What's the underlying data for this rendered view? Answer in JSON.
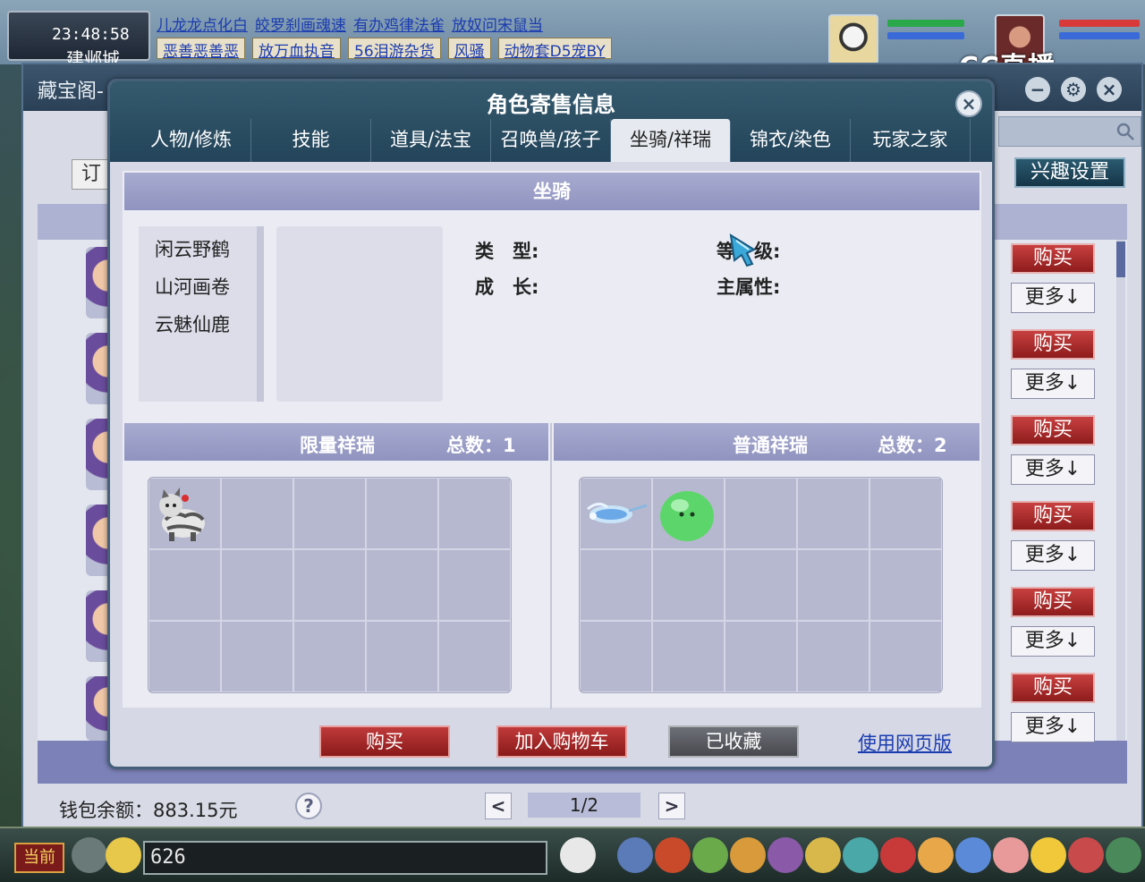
{
  "hud_top": {
    "clock": "23:48:58",
    "city": "建邺城",
    "news_row1": [
      "儿龙龙点化白",
      "皎罗刹画魂速",
      "有办鸡律法雀",
      "放奴问宋鼠当"
    ],
    "news_row2": [
      "恶善恶善恶",
      "放万血执音",
      "56泪游杂货",
      "动物套D5宠BY"
    ],
    "news_row2_mid": "风骚",
    "stream_logo": "CC直播"
  },
  "cbg_window": {
    "title": "藏宝阁-",
    "order_label": "订单",
    "interest_button": "兴趣设置",
    "rows": [
      {
        "buy": "购买",
        "more": "更多↓"
      },
      {
        "buy": "购买",
        "more": "更多↓"
      },
      {
        "buy": "购买",
        "more": "更多↓"
      },
      {
        "buy": "购买",
        "more": "更多↓"
      },
      {
        "buy": "购买",
        "more": "更多↓"
      },
      {
        "buy": "购买",
        "more": "更多↓"
      }
    ],
    "wallet_label": "钱包余额：883.15元",
    "help": "?",
    "page_prev": "<",
    "page_next": ">",
    "page_indicator": "1/2"
  },
  "modal": {
    "title": "角色寄售信息",
    "close": "×",
    "tabs": [
      "人物/修炼",
      "技能",
      "道具/法宝",
      "召唤兽/孩子",
      "坐骑/祥瑞",
      "锦衣/染色",
      "玩家之家"
    ],
    "active_tab": 4,
    "mount_section": "坐骑",
    "mounts": [
      "闲云野鹤",
      "山河画卷",
      "云魅仙鹿"
    ],
    "attributes": {
      "type_label": "类　型:",
      "level_label": "等　级:",
      "growth_label": "成　长:",
      "main_attr_label": "主属性:"
    },
    "limited": {
      "title": "限量祥瑞",
      "total": "总数：1"
    },
    "normal": {
      "title": "普通祥瑞",
      "total": "总数：2"
    },
    "buttons": {
      "buy": "购买",
      "add_cart": "加入购物车",
      "favorited": "已收藏",
      "web_version": "使用网页版"
    }
  },
  "hud_bottom": {
    "current_channel": "当前",
    "chat_input": "626"
  },
  "colors": {
    "accent_red": "#b22a2a",
    "title_bar": "#2a4a5e",
    "link_blue": "#1a3cb0"
  }
}
